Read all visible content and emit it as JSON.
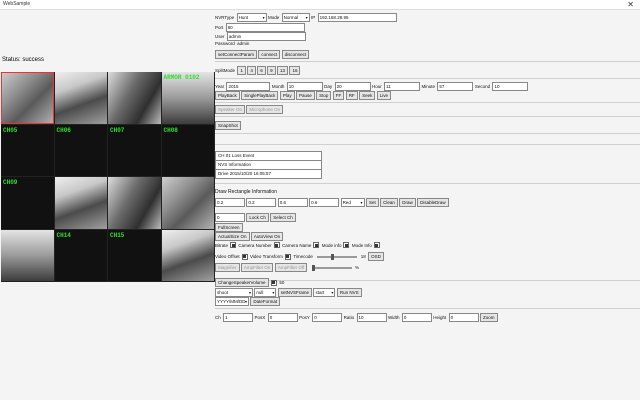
{
  "window": {
    "title": "WebSample"
  },
  "status_label": "Status: success",
  "channels": [
    {
      "label": "",
      "kind": "video",
      "style": "v1",
      "selected": true
    },
    {
      "label": "",
      "kind": "video",
      "style": "v2",
      "selected": false
    },
    {
      "label": "",
      "kind": "video",
      "style": "v3",
      "selected": false
    },
    {
      "label": "ARMOR 0102",
      "kind": "video",
      "style": "v4",
      "selected": false
    },
    {
      "label": "CH05",
      "kind": "black",
      "style": "",
      "selected": false
    },
    {
      "label": "CH06",
      "kind": "black",
      "style": "",
      "selected": false
    },
    {
      "label": "CH07",
      "kind": "black",
      "style": "",
      "selected": false
    },
    {
      "label": "CH08",
      "kind": "black",
      "style": "",
      "selected": false
    },
    {
      "label": "CH09",
      "kind": "black",
      "style": "",
      "selected": false
    },
    {
      "label": "",
      "kind": "video",
      "style": "v2",
      "selected": false
    },
    {
      "label": "",
      "kind": "video",
      "style": "v3",
      "selected": false
    },
    {
      "label": "",
      "kind": "video",
      "style": "v1",
      "selected": false
    },
    {
      "label": "",
      "kind": "video",
      "style": "v4",
      "selected": false
    },
    {
      "label": "CH14",
      "kind": "black",
      "style": "",
      "selected": false
    },
    {
      "label": "CH15",
      "kind": "black",
      "style": "",
      "selected": false
    },
    {
      "label": "",
      "kind": "video",
      "style": "v2",
      "selected": false
    }
  ],
  "connection": {
    "nvr_type_label": "NVRType",
    "nvr_type_value": "Hunt",
    "mode_label": "Mode",
    "mode_value": "Normal",
    "ip_label": "IP",
    "ip_value": "192.168.28.95",
    "port_label": "Port",
    "port_value": "80",
    "user_label": "User",
    "user_value": "admin",
    "password_label": "Password",
    "password_value": "admin",
    "set_connect_param": "setConnectParam",
    "connect": "connect",
    "disconnect": "disconnect"
  },
  "split": {
    "label": "SplitMode",
    "options": [
      "1",
      "4",
      "6",
      "9",
      "13",
      "16"
    ]
  },
  "playback": {
    "year_label": "Year",
    "year_value": "2015",
    "month_label": "Month",
    "month_value": "10",
    "day_label": "Day",
    "day_value": "20",
    "hour_label": "Hour",
    "hour_value": "11",
    "minute_label": "Minute",
    "minute_value": "57",
    "second_label": "Second",
    "second_value": "10",
    "buttons": [
      "PlayBack",
      "SinglePlayBack",
      "Play",
      "Pause",
      "Stop",
      "FF",
      "RF",
      "Seek",
      "Live"
    ]
  },
  "speaker": {
    "speaker_on": "Speaker On",
    "microphone_on": "Microphone On"
  },
  "snapshot": "SnapShot",
  "info": {
    "lines": [
      "CH 01 Loss Event",
      "NVS Information",
      "Drive    2015/10/20 16:05:57"
    ]
  },
  "draw": {
    "title": "Draw Rectangle Information",
    "values": [
      "0.2",
      "0.2",
      "0.6",
      "0.6"
    ],
    "color": "Red",
    "buttons": [
      "Set",
      "Clean",
      "Draw",
      "DisableDraw"
    ]
  },
  "lock": {
    "value": "0",
    "lock_ch": "Lock Ch",
    "select_ch": "Select Ch"
  },
  "full_screen": "FullScreen",
  "actual_size": {
    "actual": "ActualSize On",
    "auto_view": "AutoView On"
  },
  "overlay": {
    "items": [
      {
        "label": "Bitrate",
        "on": true
      },
      {
        "label": "Camera Number",
        "on": true
      },
      {
        "label": "Camera Name",
        "on": true
      },
      {
        "label": "Mode info",
        "on": true
      },
      {
        "label": "Mode Info",
        "on": true
      }
    ],
    "row2": [
      {
        "label": "Video Offset",
        "on": true
      },
      {
        "label": "Video Transform",
        "on": true
      },
      {
        "label": "Timecode",
        "on": true
      }
    ],
    "osd_button": "OSD",
    "slider_value": "18"
  },
  "magnifier": {
    "buttons": [
      "Magnifier",
      "AmpFilter On",
      "AmpFilter Off"
    ],
    "percent": "%"
  },
  "volume": {
    "button": "ChangeSpeakerVolume",
    "value": "50",
    "checked": true
  },
  "misc": {
    "sel1": "shoot",
    "sel2": "null",
    "set_nvs_frame": "setNVSFrame",
    "sel3": "start",
    "run_nvs": "Run NVS"
  },
  "date_format": {
    "value": "YYYY/MM/DD",
    "button": "DateFormat"
  },
  "zoom": {
    "ch_label": "Ch",
    "ch_value": "1",
    "pos_x_label": "PosX",
    "pos_x_value": "0",
    "pos_y_label": "PosY",
    "pos_y_value": "0",
    "ratio_label": "Ratio",
    "ratio_value": "10",
    "width_label": "Width",
    "width_value": "0",
    "height_label": "Height",
    "height_value": "0",
    "button": "Zoom"
  }
}
